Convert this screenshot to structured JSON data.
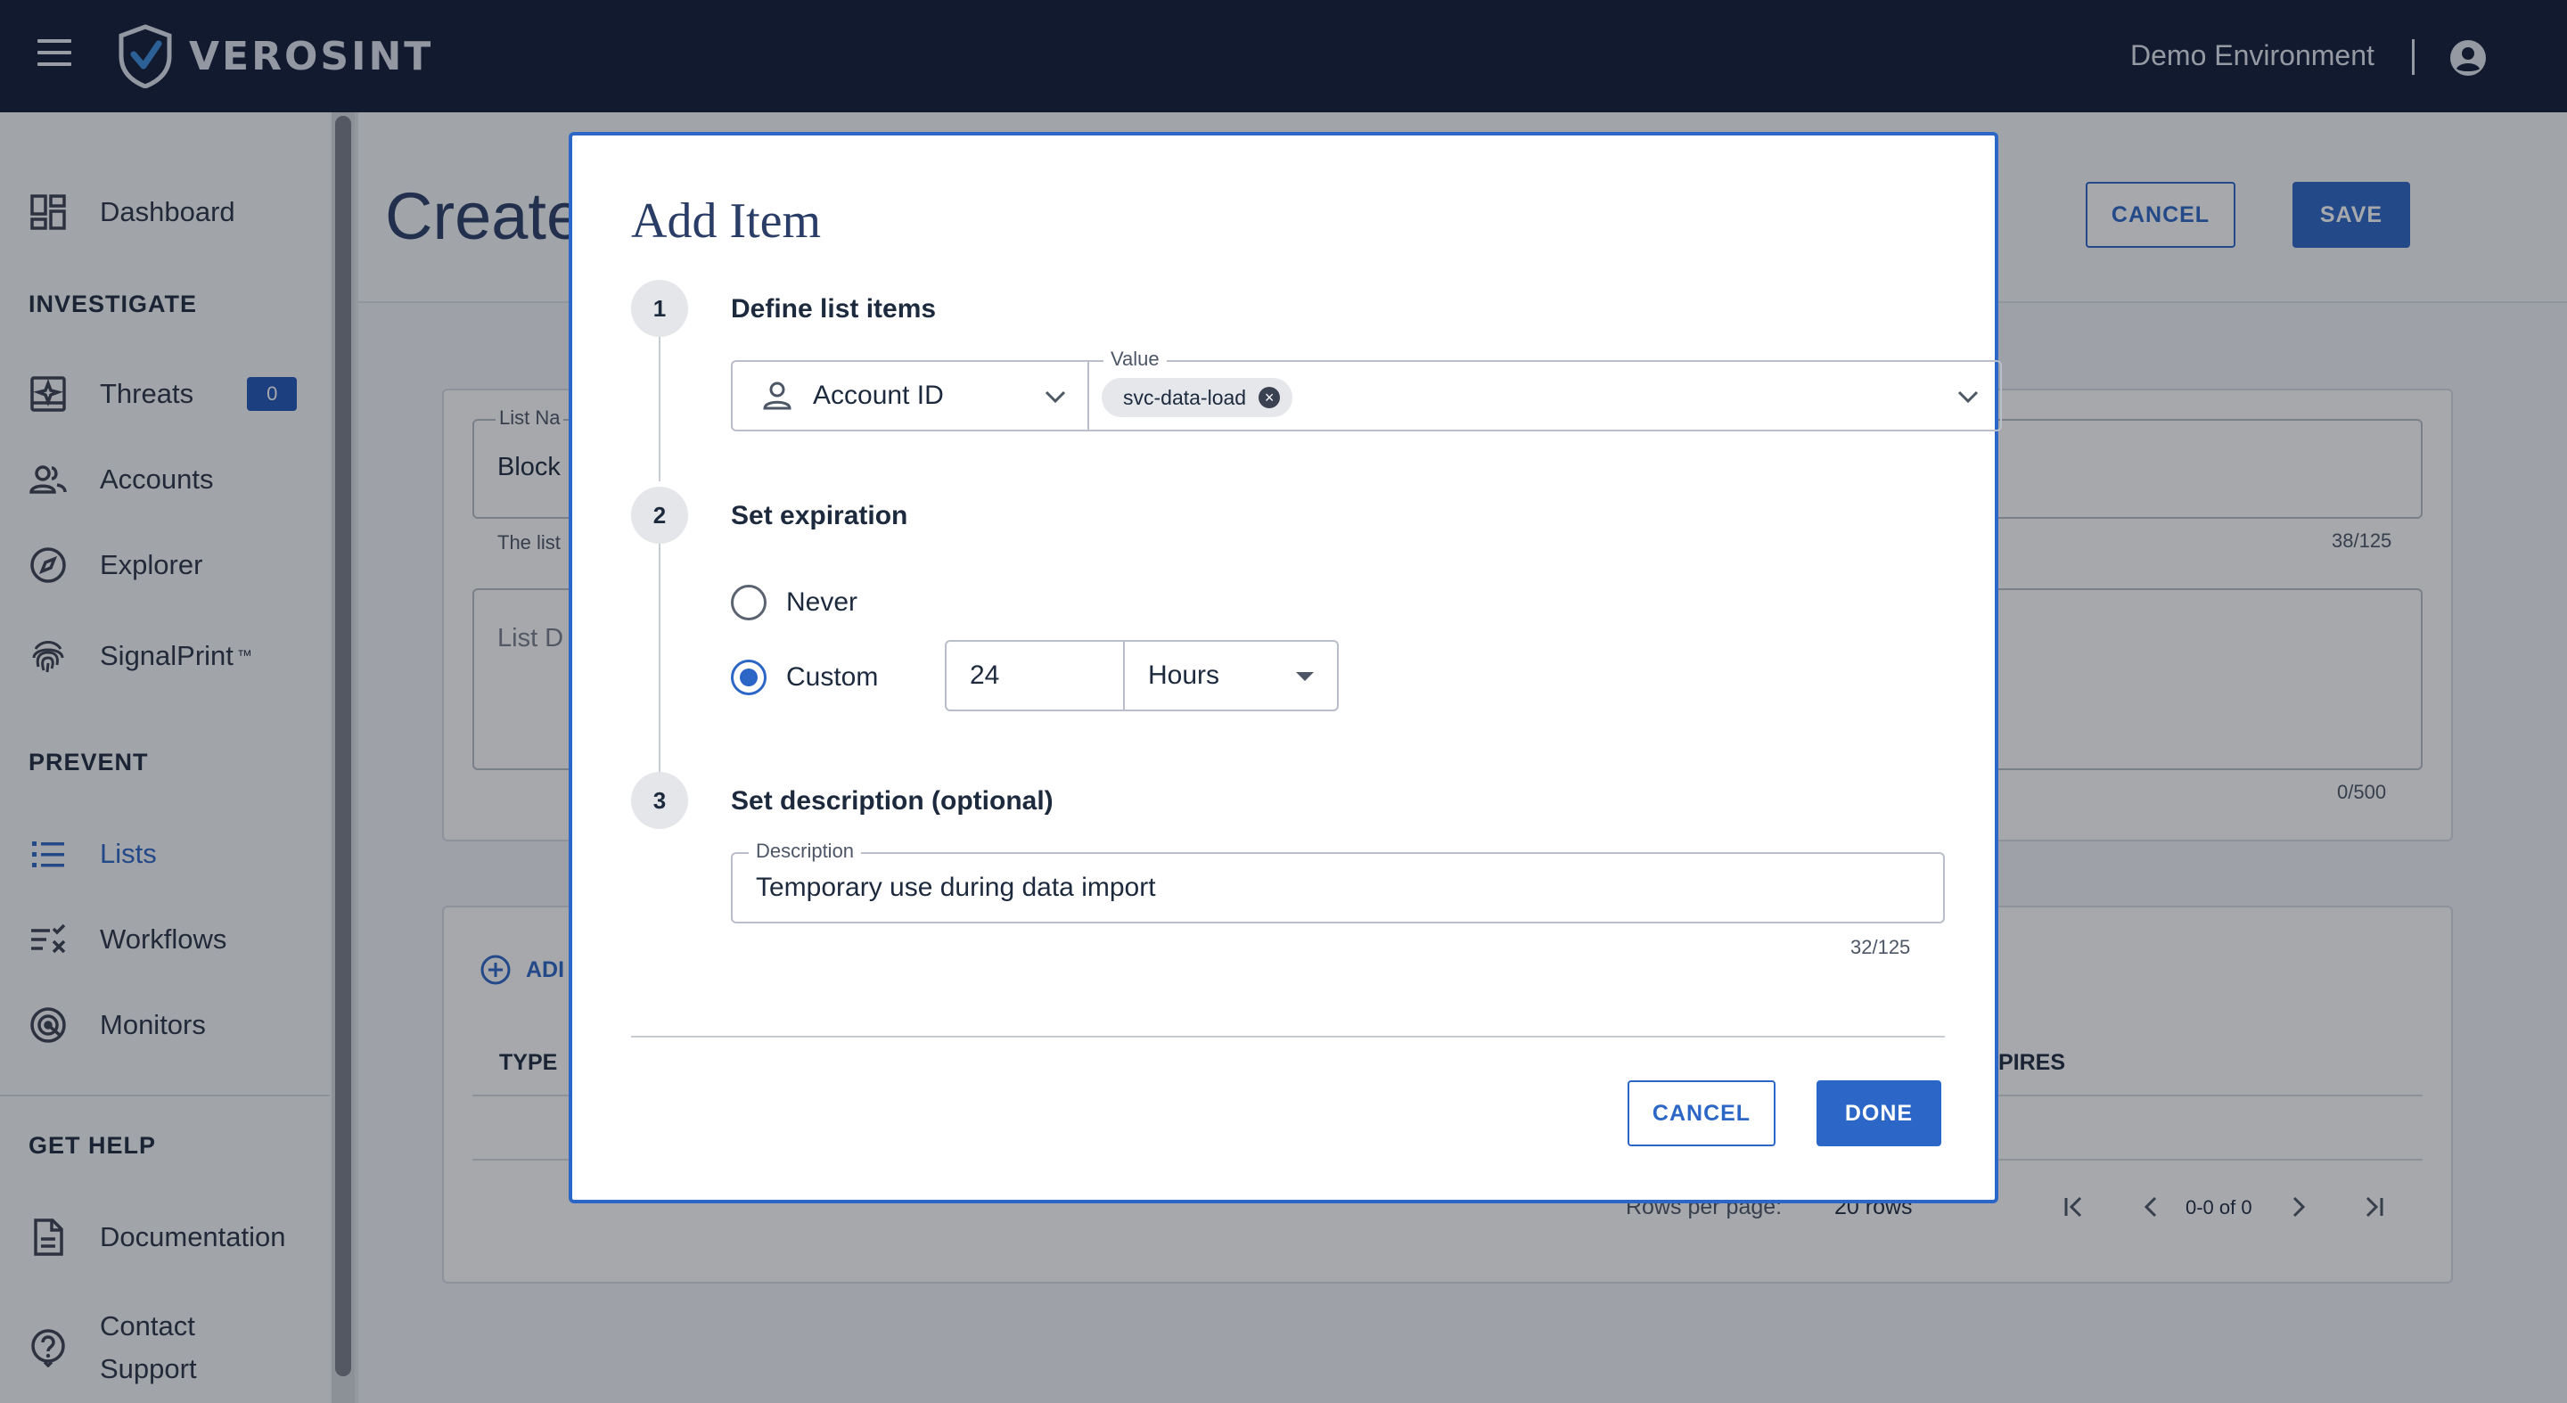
{
  "topbar": {
    "brand": "VEROSINT",
    "environment": "Demo Environment"
  },
  "sidebar": {
    "dashboard": "Dashboard",
    "section_investigate": "INVESTIGATE",
    "threats": "Threats",
    "threats_count": "0",
    "accounts": "Accounts",
    "explorer": "Explorer",
    "signalprint": "SignalPrint",
    "signalprint_tm": "™",
    "section_prevent": "PREVENT",
    "lists": "Lists",
    "workflows": "Workflows",
    "monitors": "Monitors",
    "section_help": "GET HELP",
    "documentation": "Documentation",
    "contact_support_1": "Contact",
    "contact_support_2": "Support"
  },
  "background": {
    "page_title": "Create",
    "cancel_label": "CANCEL",
    "save_label": "SAVE",
    "list_name_label": "List Na",
    "list_name_value": "Block",
    "list_name_help": "The list",
    "list_name_counter": "38/125",
    "list_desc_placeholder": "List D",
    "list_desc_counter": "0/500",
    "add_label": "ADI",
    "col_type": "TYPE",
    "col_expires": "PIRES",
    "rows_per_page_label": "Rows per page:",
    "rows_per_page_value": "20 rows",
    "pagination_range": "0-0 of 0"
  },
  "dialog": {
    "title": "Add Item",
    "step1": {
      "number": "1",
      "title": "Define list items",
      "type_value": "Account ID",
      "value_label": "Value",
      "chip": "svc-data-load"
    },
    "step2": {
      "number": "2",
      "title": "Set expiration",
      "never_label": "Never",
      "custom_label": "Custom",
      "custom_amount": "24",
      "custom_unit": "Hours"
    },
    "step3": {
      "number": "3",
      "title": "Set description (optional)",
      "desc_label": "Description",
      "desc_value": "Temporary use during data import",
      "desc_counter": "32/125"
    },
    "cancel_label": "CANCEL",
    "done_label": "DONE"
  },
  "colors": {
    "accent": "#2c66c6",
    "topbar": "#111b36",
    "title": "#2a3d66"
  }
}
